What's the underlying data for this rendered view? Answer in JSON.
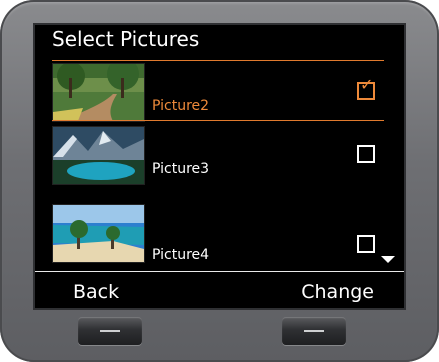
{
  "title": "Select Pictures",
  "items": [
    {
      "label": "Picture2",
      "checked": true,
      "icon": "park-path-thumbnail"
    },
    {
      "label": "Picture3",
      "checked": false,
      "icon": "mountain-lake-thumbnail"
    },
    {
      "label": "Picture4",
      "checked": false,
      "icon": "beach-thumbnail"
    }
  ],
  "softkeys": {
    "left": "Back",
    "right": "Change"
  },
  "colors": {
    "accent": "#ee8a3a",
    "screen": "#000000",
    "device": "#6e6f73"
  },
  "scroll_indicator": "down-arrow-icon"
}
